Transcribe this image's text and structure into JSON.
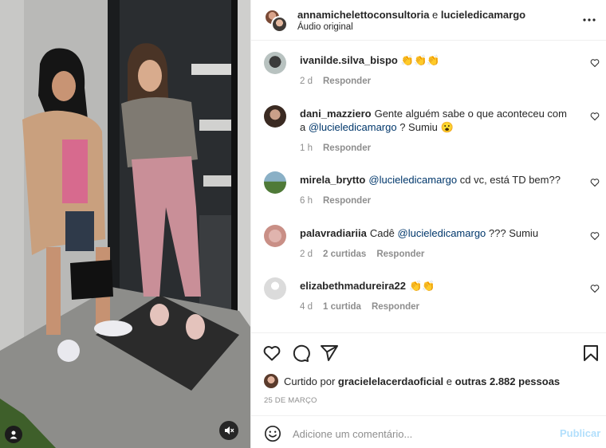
{
  "header": {
    "author_1": "annamichelettoconsultoria",
    "conjunction": " e ",
    "author_2": "lucieledicamargo",
    "subtitle": "Áudio original",
    "more_icon": "more-horizontal-icon"
  },
  "comments": [
    {
      "user": "ivanilde.silva_bispo",
      "text": "👏👏👏",
      "mention": "",
      "text_after": "",
      "age": "2 d",
      "likes": "",
      "reply": "Responder"
    },
    {
      "user": "dani_mazziero",
      "text": "Gente alguém sabe o que aconteceu com a ",
      "mention": "@lucieledicamargo",
      "text_after": " ? Sumiu 😮",
      "age": "1 h",
      "likes": "",
      "reply": "Responder"
    },
    {
      "user": "mirela_brytto",
      "text": "",
      "mention": "@lucieledicamargo",
      "text_after": " cd vc, está TD bem??",
      "age": "6 h",
      "likes": "",
      "reply": "Responder"
    },
    {
      "user": "palavradiariia",
      "text": "Cadê ",
      "mention": "@lucieledicamargo",
      "text_after": " ??? Sumiu",
      "age": "2 d",
      "likes": "2 curtidas",
      "reply": "Responder"
    },
    {
      "user": "elizabethmadureira22",
      "text": "👏👏",
      "mention": "",
      "text_after": "",
      "age": "4 d",
      "likes": "1 curtida",
      "reply": "Responder"
    }
  ],
  "actions": {
    "like_icon": "heart-icon",
    "comment_icon": "comment-icon",
    "share_icon": "send-icon",
    "save_icon": "bookmark-icon"
  },
  "likes": {
    "prefix": "Curtido por ",
    "user": "gracielelacerdaoficial",
    "middle": " e ",
    "others": "outras 2.882 pessoas"
  },
  "date": "25 DE MARÇO",
  "composer": {
    "placeholder": "Adicione um comentário...",
    "publish": "Publicar",
    "emoji_icon": "smiley-icon"
  },
  "media": {
    "mute_icon": "speaker-muted-icon",
    "user_icon": "user-tag-icon"
  },
  "colors": {
    "mention": "#00376b",
    "secondary_text": "#8e8e8e",
    "publish_disabled": "#b2dffc",
    "divider": "#efefef"
  }
}
